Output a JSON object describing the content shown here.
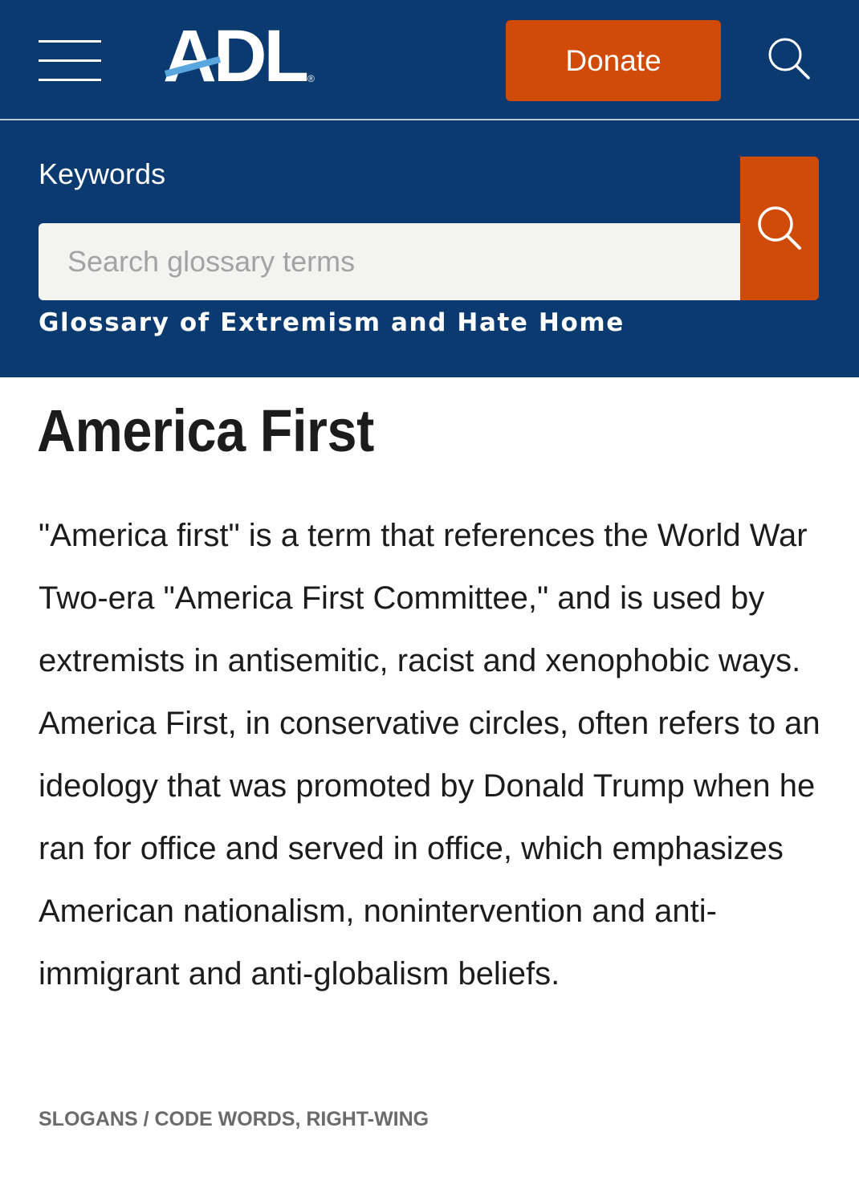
{
  "header": {
    "logo_text": "ADL",
    "logo_mark": "®",
    "menu_icon": "hamburger-menu-icon",
    "donate_label": "Donate",
    "search_icon": "search-icon",
    "background_color": "#0b3a70",
    "accent_color": "#d04a08"
  },
  "search": {
    "label": "Keywords",
    "placeholder": "Search glossary terms",
    "value": "",
    "button_icon": "search-icon",
    "home_link": "Glossary of Extremism and Hate Home"
  },
  "article": {
    "title": "America First",
    "body": "\"America first\" is a term that references the World War Two-era \"America First Committee,\" and is used by extremists in antisemitic, racist and xenophobic ways. America First, in conservative circles, often refers to an ideology that was promoted by Donald Trump when he ran for office and served in office, which emphasizes American nationalism, nonintervention and anti-immigrant and anti-globalism beliefs.",
    "tags": "SLOGANS / CODE WORDS, RIGHT-WING"
  }
}
